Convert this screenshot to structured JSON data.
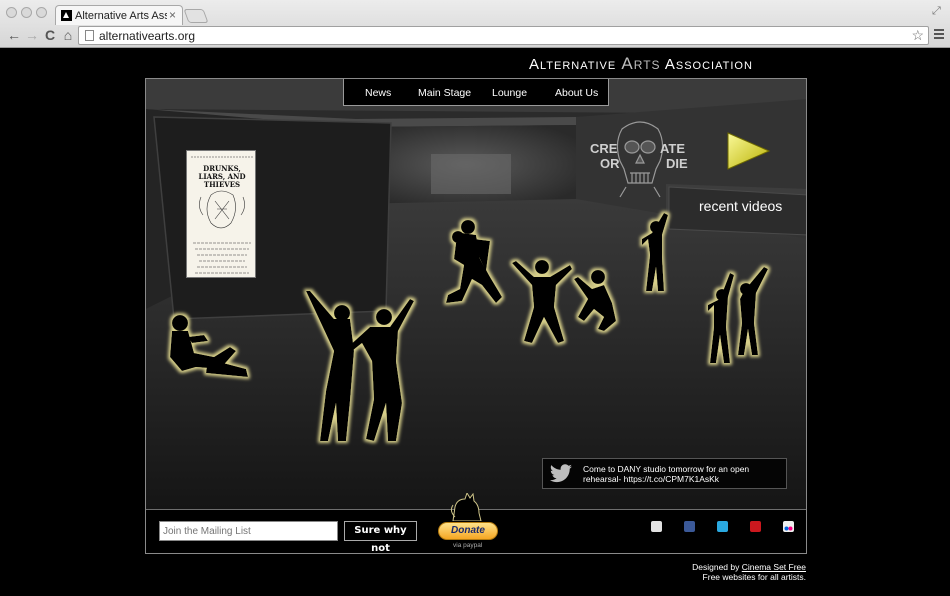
{
  "browser": {
    "tab_title": "Alternative Arts Associatio",
    "tab_close": "×",
    "url": "alternativearts.org",
    "back": "←",
    "forward": "→",
    "reload": "C",
    "home": "⌂",
    "star": "☆"
  },
  "site": {
    "title_part1": "Alternative",
    "title_part2": "Arts",
    "title_part3": "Association"
  },
  "nav": {
    "items": [
      "News",
      "Main Stage",
      "Lounge",
      "About Us"
    ]
  },
  "poster": {
    "heading": "DRUNKS, LIARS, AND THIEVES"
  },
  "recent_videos_label": "recent videos",
  "skull": {
    "text_left_top": "CRE",
    "text_right_top": "ATE",
    "text_left_bottom": "OR",
    "text_right_bottom": "DIE"
  },
  "tweet": {
    "text": "Come to DANY studio tomorrow for an open rehearsal- https://t.co/CPM7K1AsKk"
  },
  "mailing": {
    "placeholder": "Join the Mailing List",
    "button_label": "Sure why not"
  },
  "donate": {
    "label": "Donate",
    "via": "via paypal"
  },
  "social": [
    {
      "name": "email-icon",
      "color": "#d9d9d9"
    },
    {
      "name": "facebook-icon",
      "color": "#3b5998"
    },
    {
      "name": "twitter-icon",
      "color": "#2aa9e0"
    },
    {
      "name": "youtube-icon",
      "color": "#cc181e"
    },
    {
      "name": "flickr-icon",
      "color": "#e8e8e8"
    }
  ],
  "credit": {
    "designed_by": "Designed by",
    "designer": "Cinema Set Free",
    "tagline": "Free websites for all artists."
  },
  "colors": {
    "glow": "#c8c27a",
    "play": "#e2df18"
  }
}
